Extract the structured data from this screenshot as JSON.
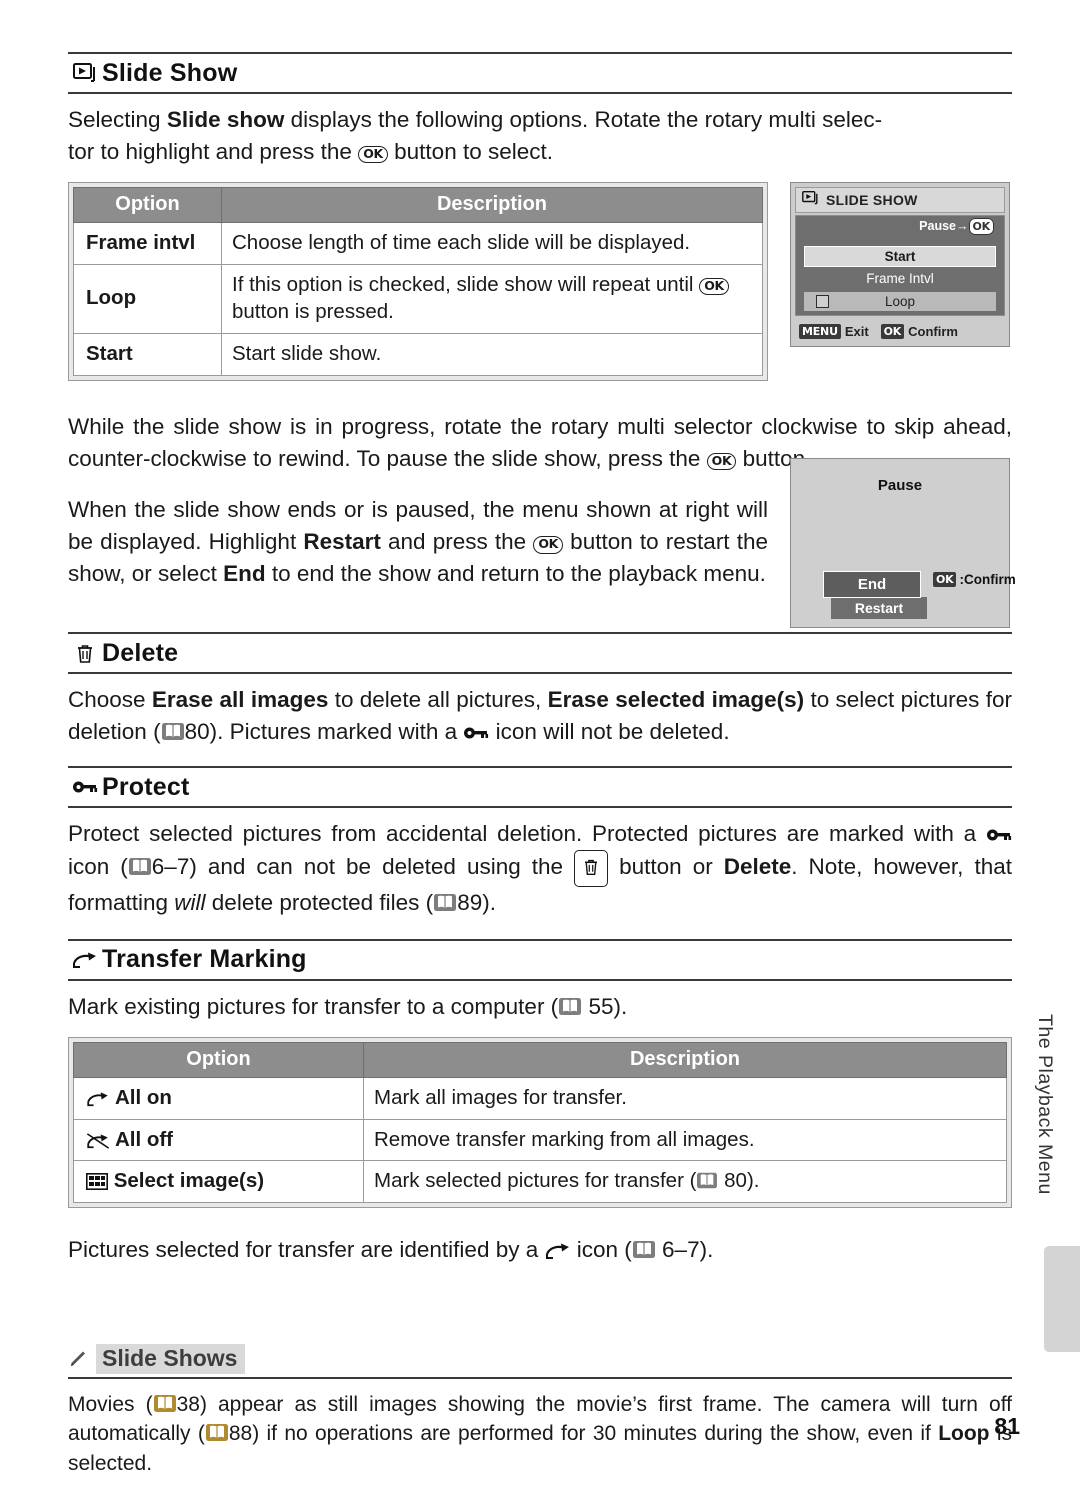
{
  "page": {
    "number": "81",
    "side_tab_text": "The Playback Menu"
  },
  "slide_show": {
    "heading": "Slide Show",
    "intro_part1": "Selecting ",
    "intro_bold": "Slide show",
    "intro_part2": " displays the following options.  Rotate the rotary multi selec-",
    "intro_line2_a": "tor to highlight and press the ",
    "intro_line2_b": " button to select.",
    "table": {
      "headers": [
        "Option",
        "Description"
      ],
      "rows": [
        {
          "option": "Frame intvl",
          "description": "Choose length of time each slide will be displayed."
        },
        {
          "option": "Loop",
          "description_a": "If this option is checked, slide show will repeat until ",
          "description_b": "button is pressed."
        },
        {
          "option": "Start",
          "description": "Start slide show."
        }
      ]
    },
    "para2_a": "While the slide show is in progress, rotate the rotary multi selector clockwise to skip ahead, counter-clockwise to rewind.  To pause the slide show, press the ",
    "para2_b": " button.",
    "para3_a": "When the slide show ends or is paused, the menu shown at right will be displayed.  Highlight ",
    "para3_restart": "Restart",
    "para3_b": " and press the ",
    "para3_c": " button to restart the show, or select ",
    "para3_end": "End",
    "para3_d": " to end the show and return to the playback menu."
  },
  "lcd_slideshow": {
    "title": "SLIDE SHOW",
    "pause_hint": "Pause",
    "pause_arrow": "→",
    "pause_ok": "OK",
    "items": [
      "Start",
      "Frame Intvl",
      "Loop"
    ],
    "footer_menu_badge": "MENU",
    "footer_exit": "Exit",
    "footer_ok_badge": "OK",
    "footer_confirm": "Confirm"
  },
  "lcd_pause": {
    "title": "Pause",
    "end_label": "End",
    "restart_label": "Restart",
    "confirm_badge": "OK",
    "confirm_label": ":Confirm"
  },
  "delete": {
    "heading": "Delete",
    "body_a": "Choose ",
    "erase_all": "Erase all images",
    "body_b": " to delete all pictures, ",
    "erase_selected": "Erase selected image(s)",
    "body_c": " to select pictures for deletion (",
    "ref_80": "80",
    "body_d": ").  Pictures marked with a ",
    "body_e": " icon will not be deleted."
  },
  "protect": {
    "heading": "Protect",
    "body_a": "Protect selected pictures from accidental deletion.  Protected pictures are marked with a ",
    "body_b": " icon (",
    "ref_6_7": "6–7",
    "body_c": ") and can not be deleted using the ",
    "body_d": " button or ",
    "delete_bold": "Delete",
    "body_e": ".  Note, however, that formatting ",
    "will_italic": "will",
    "body_f": " delete protected files (",
    "ref_89": "89",
    "body_g": ")."
  },
  "transfer": {
    "heading": "Transfer Marking",
    "body_a": "Mark existing pictures for transfer to a computer (",
    "ref_55": "55",
    "body_b": ").",
    "table": {
      "headers": [
        "Option",
        "Description"
      ],
      "rows": [
        {
          "option": "All on",
          "description": "Mark all images for transfer."
        },
        {
          "option": "All off",
          "description": "Remove transfer marking from all images."
        },
        {
          "option": "Select image(s)",
          "description_a": "Mark selected pictures for transfer (",
          "ref": "80",
          "description_b": ")."
        }
      ]
    },
    "closing_a": "Pictures selected for transfer are identified by a ",
    "closing_b": " icon (",
    "closing_ref": "6–7",
    "closing_c": ")."
  },
  "tip": {
    "title": "Slide Shows",
    "body_a": "Movies (",
    "ref_38": "38",
    "body_b": ") appear as still images showing the movie’s first frame.  The camera will turn off automatically (",
    "ref_88": "88",
    "body_c": ") if no operations are performed for 30 minutes during the show, even if ",
    "loop_bold": "Loop",
    "body_d": " is selected."
  },
  "colors": {
    "table_header_bg": "#8d8d8d",
    "rule": "#3a3a3a",
    "lcd_bg": "#cccccc",
    "lcd_dark": "#6e6e6e",
    "tip_title_bg": "#d9d9d9"
  }
}
